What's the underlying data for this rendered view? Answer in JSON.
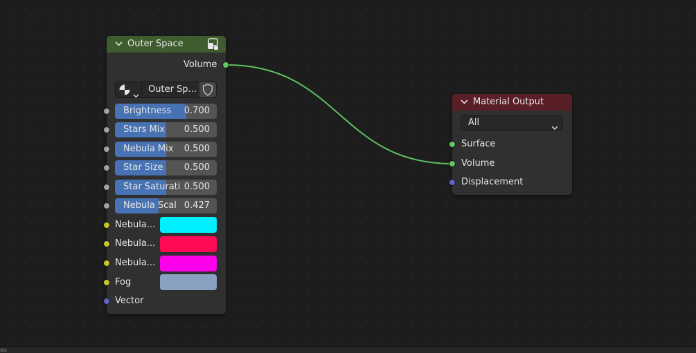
{
  "bottom_bar": {
    "text": "ou"
  },
  "nodes": {
    "outer_space": {
      "title": "Outer Space",
      "header_color": "#3e5c2d",
      "output_label": "Volume",
      "datablock_name": "Outer Sp...",
      "inputs": [
        {
          "label": "Brightness",
          "value": "0.700",
          "fill": 0.7
        },
        {
          "label": "Stars Mix",
          "value": "0.500",
          "fill": 0.5
        },
        {
          "label": "Nebula Mix",
          "value": "0.500",
          "fill": 0.5
        },
        {
          "label": "Star Size",
          "value": "0.500",
          "fill": 0.5
        },
        {
          "label": "Star Saturati",
          "value": "0.500",
          "fill": 0.5
        },
        {
          "label": "Nebula Scal",
          "value": "0.427",
          "fill": 0.427
        }
      ],
      "color_inputs": [
        {
          "label": "Nebula...",
          "color": "#00f0ff"
        },
        {
          "label": "Nebula...",
          "color": "#ff0a55"
        },
        {
          "label": "Nebula...",
          "color": "#ff00ea"
        },
        {
          "label": "Fog",
          "color": "#8aa2c2"
        }
      ],
      "vector_label": "Vector"
    },
    "material_output": {
      "title": "Material Output",
      "header_color": "#5a1e26",
      "target_value": "All",
      "inputs": [
        "Surface",
        "Volume",
        "Displacement"
      ]
    }
  }
}
